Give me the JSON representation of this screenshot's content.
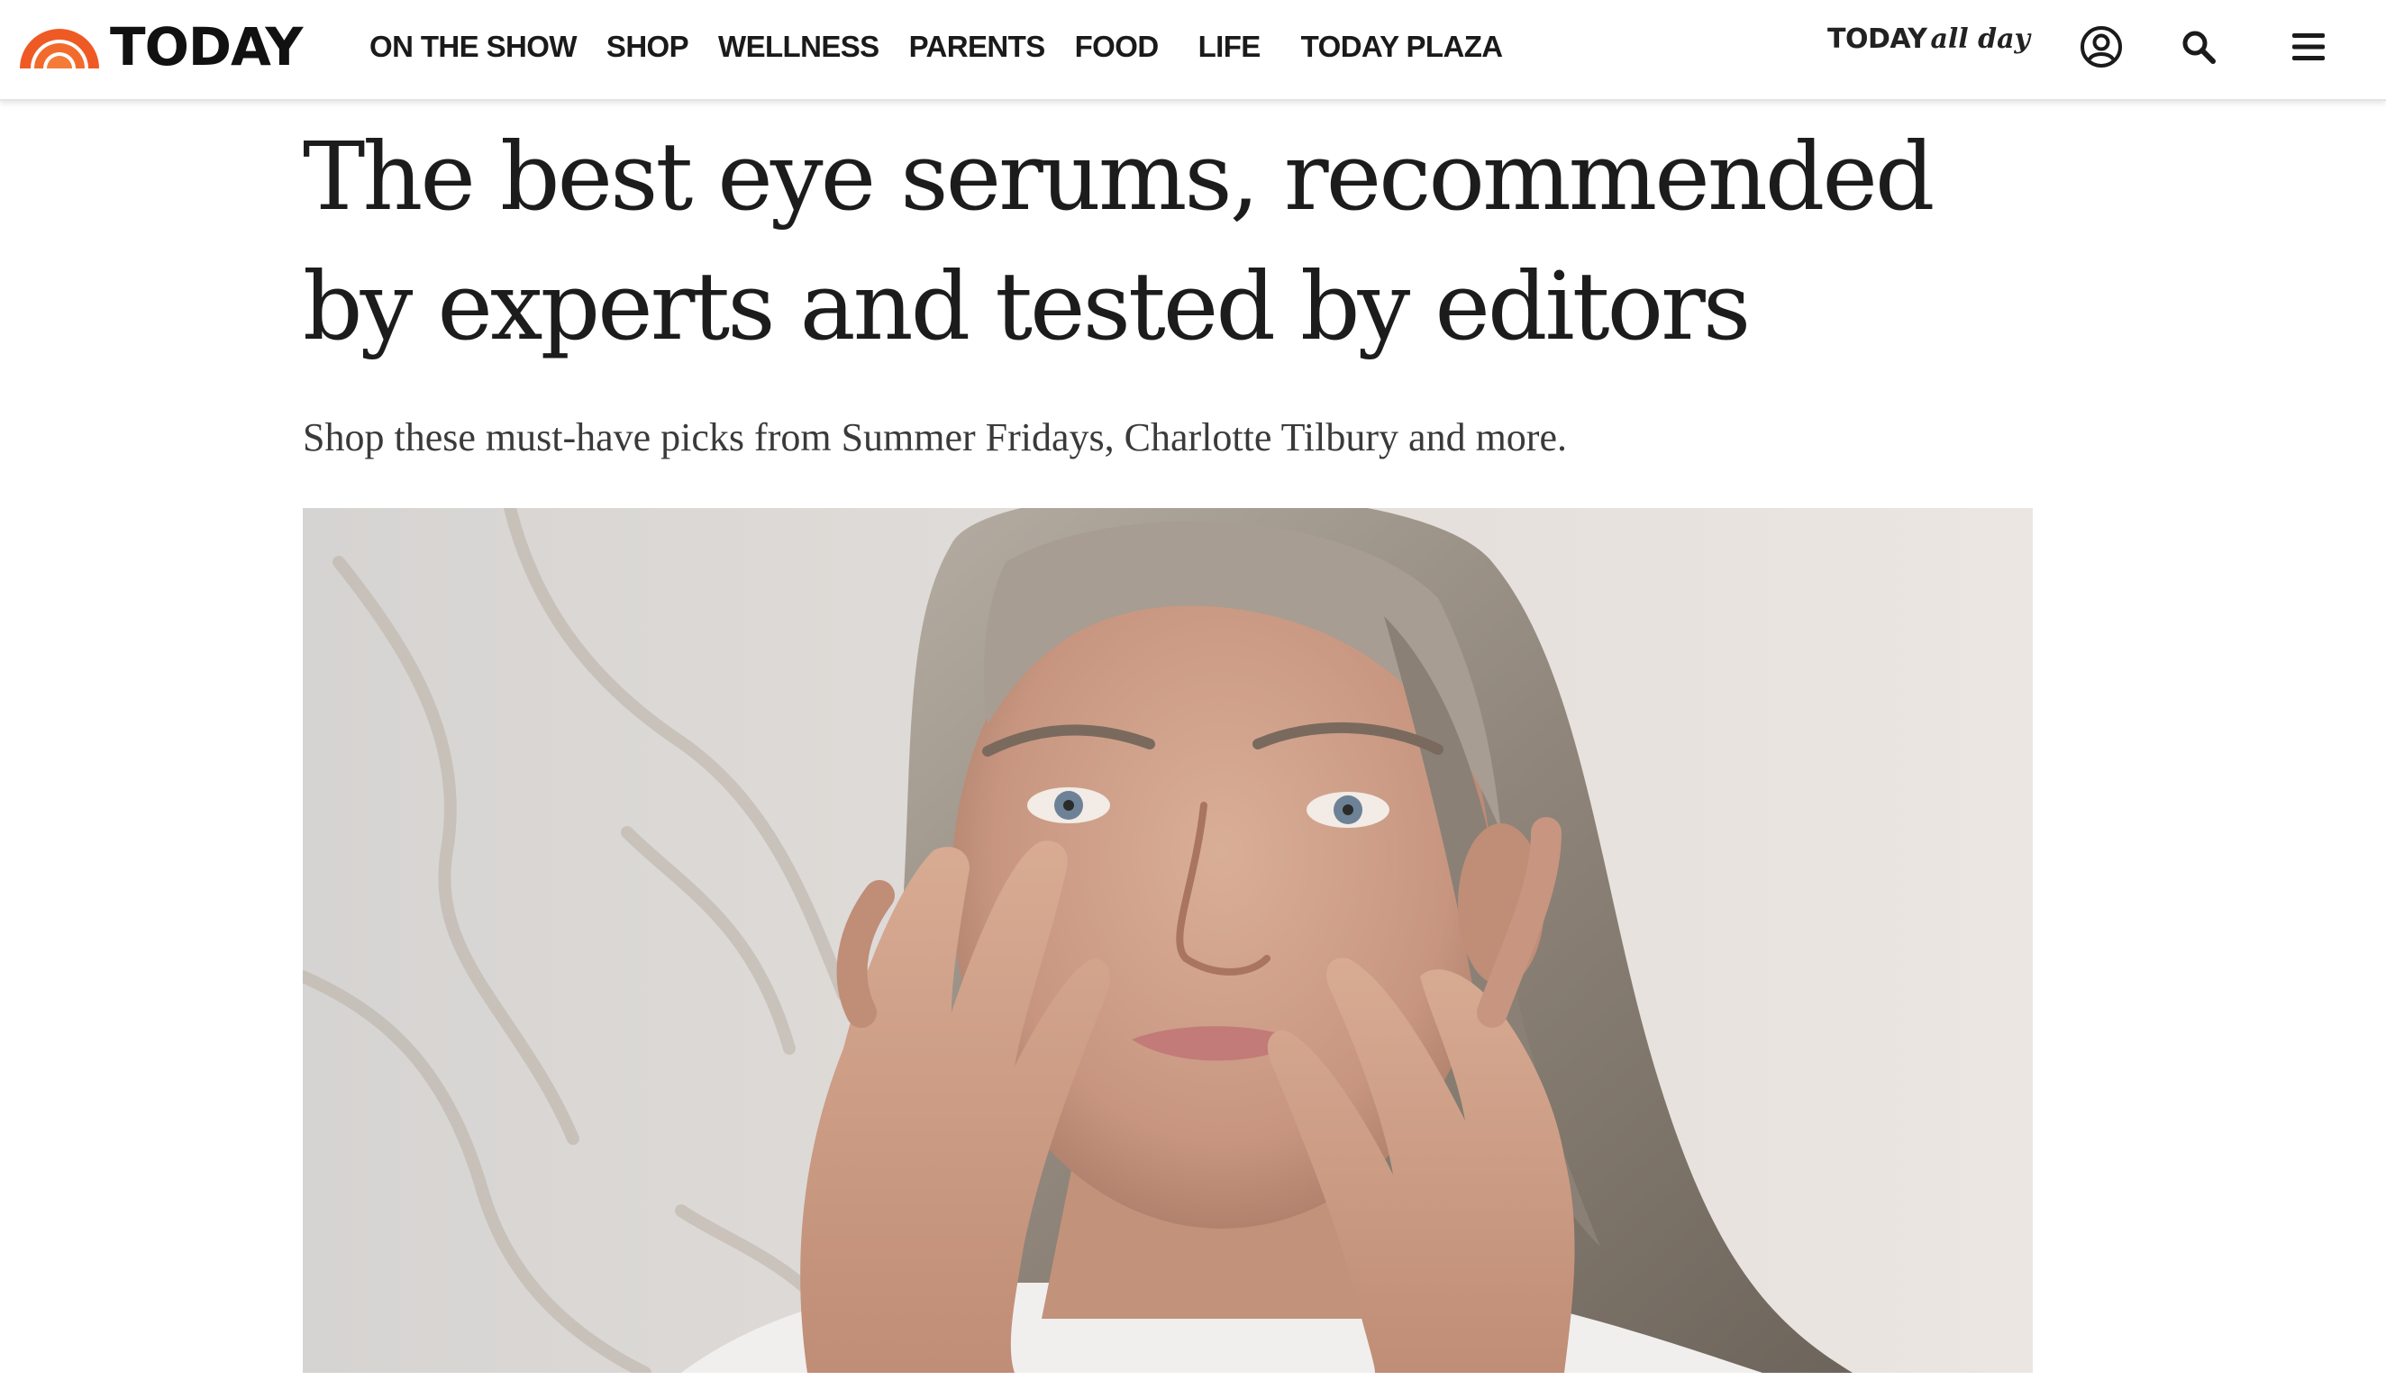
{
  "header": {
    "logo_text": "TODAY",
    "logo_icon": "rainbow-arc-logo",
    "brand_color": "#e64a19",
    "nav": [
      "ON THE SHOW",
      "SHOP",
      "WELLNESS",
      "PARENTS",
      "FOOD",
      "LIFE",
      "TODAY PLAZA"
    ],
    "allday": {
      "word": "TODAY",
      "script": "all day"
    },
    "icons": [
      "user-icon",
      "search-icon",
      "menu-icon"
    ]
  },
  "article": {
    "headline": "The best eye serums, recommended by experts and tested by editors",
    "dek": "Shop these must-have picks from Summer Fridays, Charlotte Tilbury and more.",
    "hero_image": "woman-applying-eye-serum-photo"
  }
}
